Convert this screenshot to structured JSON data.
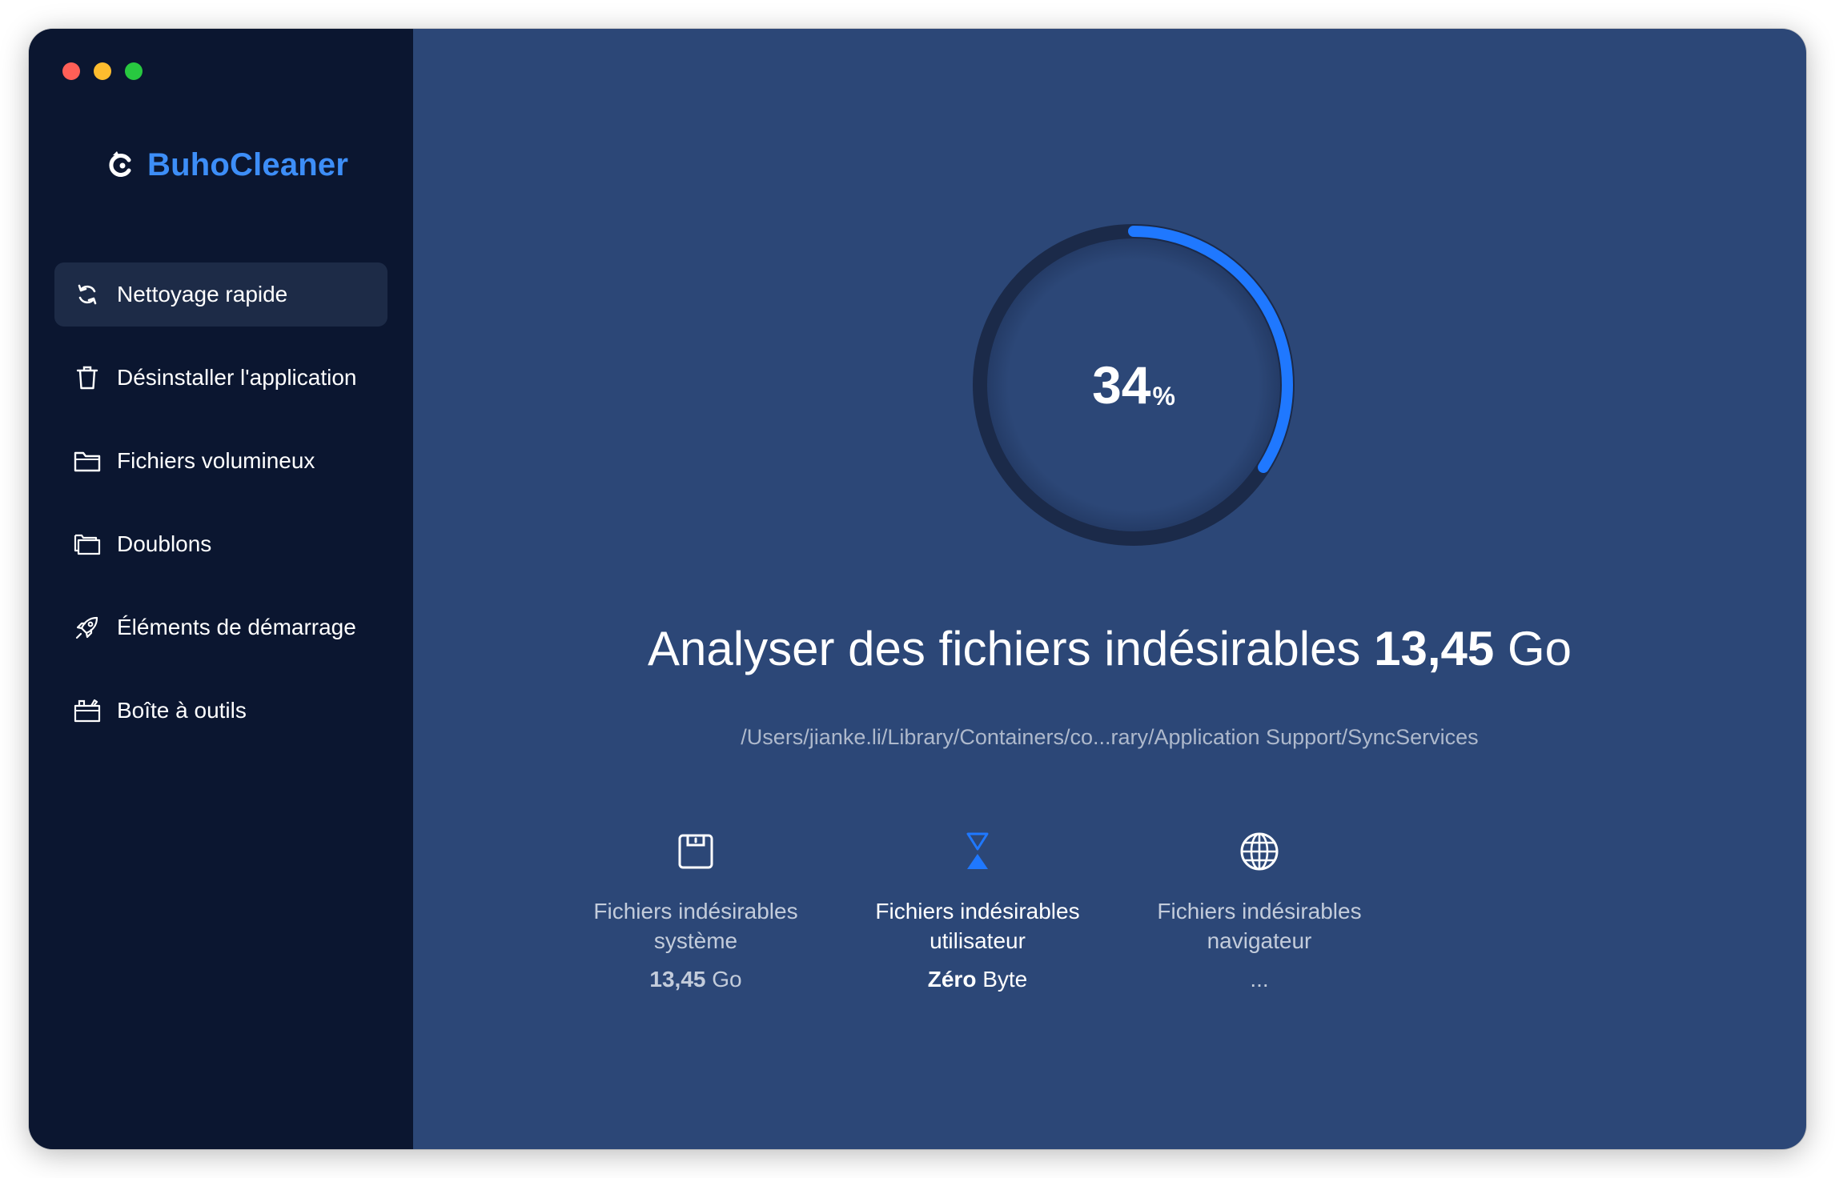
{
  "brand": {
    "name": "BuhoCleaner",
    "accent": "#3d8ef8"
  },
  "sidebar": {
    "items": [
      {
        "label": "Nettoyage rapide",
        "icon": "refresh-icon",
        "active": true
      },
      {
        "label": "Désinstaller l'application",
        "icon": "trash-icon",
        "active": false
      },
      {
        "label": "Fichiers volumineux",
        "icon": "folder-icon",
        "active": false
      },
      {
        "label": "Doublons",
        "icon": "duplicate-folder-icon",
        "active": false
      },
      {
        "label": "Éléments de démarrage",
        "icon": "rocket-icon",
        "active": false
      },
      {
        "label": "Boîte à outils",
        "icon": "toolbox-icon",
        "active": false
      }
    ]
  },
  "scan": {
    "progress_value": "34",
    "progress_unit": "%",
    "progress_fraction": 0.34,
    "progress_color": "#1f78ff",
    "headline_prefix": "Analyser des fichiers indésirables",
    "headline_size": "13,45",
    "headline_unit": "Go",
    "current_path": "/Users/jianke.li/Library/Containers/co...rary/Application Support/SyncServices"
  },
  "categories": [
    {
      "title_line1": "Fichiers indésirables",
      "title_line2": "système",
      "value_num": "13,45",
      "value_unit": "Go",
      "icon": "disk-icon",
      "active": false
    },
    {
      "title_line1": "Fichiers indésirables",
      "title_line2": "utilisateur",
      "value_num": "Zéro",
      "value_unit": "Byte",
      "icon": "hourglass-icon",
      "active": true
    },
    {
      "title_line1": "Fichiers indésirables",
      "title_line2": "navigateur",
      "value_num": "",
      "value_unit": "...",
      "icon": "globe-icon",
      "active": false
    }
  ]
}
